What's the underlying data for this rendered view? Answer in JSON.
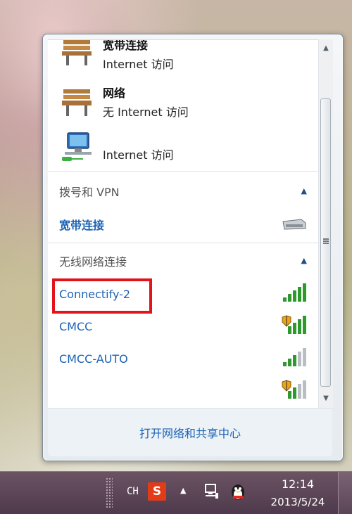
{
  "connections": [
    {
      "name": "宽带连接",
      "status": "Internet 访问",
      "icon": "bench-network-icon"
    },
    {
      "name": "网络",
      "status": "无 Internet 访问",
      "icon": "bench-network-icon"
    },
    {
      "name": "",
      "status": "Internet 访问",
      "icon": "computer-network-icon"
    }
  ],
  "dialup": {
    "title": "拨号和 VPN",
    "items": [
      {
        "label": "宽带连接",
        "icon": "modem-icon"
      }
    ]
  },
  "wireless": {
    "title": "无线网络连接",
    "networks": [
      {
        "name": "Connectify-2",
        "secured": false,
        "highlighted": true
      },
      {
        "name": "CMCC",
        "secured": true
      },
      {
        "name": "CMCC-AUTO",
        "secured": false
      },
      {
        "name": "",
        "secured": true
      }
    ]
  },
  "footer": {
    "link": "打开网络和共享中心"
  },
  "taskbar": {
    "ime": "CH",
    "sogou": "S",
    "time": "12:14",
    "date": "2013/5/24"
  },
  "colors": {
    "link": "#1d63b3",
    "highlight": "#e0141a",
    "taskbar": "#5a4558"
  }
}
